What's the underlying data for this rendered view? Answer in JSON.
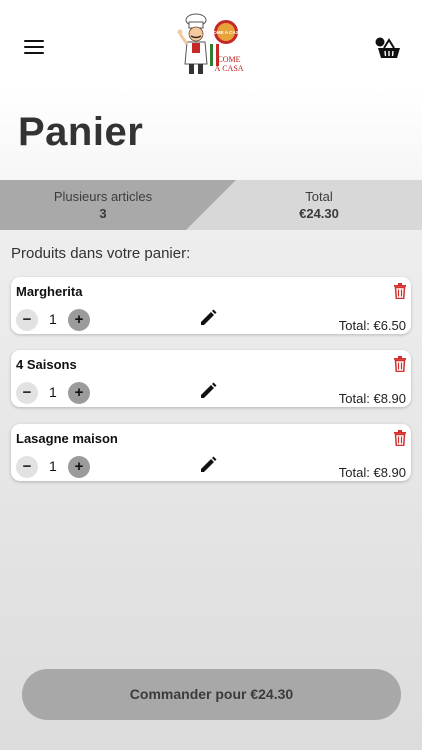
{
  "logo": {
    "brand_text_line1": "COME",
    "brand_text_line2": "À CASA",
    "badge_text": "COME A CASA"
  },
  "header": {
    "menu_icon": "hamburger-menu-icon",
    "cart_icon": "shopping-basket-icon"
  },
  "page": {
    "title": "Panier"
  },
  "summary": {
    "count_label": "Plusieurs articles",
    "count_value": "3",
    "total_label": "Total",
    "total_value": "€24.30"
  },
  "cart": {
    "section_label": "Produits dans votre panier:",
    "items": [
      {
        "name": "Margherita",
        "quantity": "1",
        "total": "Total: €6.50"
      },
      {
        "name": "4 Saisons",
        "quantity": "1",
        "total": "Total: €8.90"
      },
      {
        "name": "Lasagne maison",
        "quantity": "1",
        "total": "Total: €8.90"
      }
    ],
    "minus_glyph": "−",
    "plus_glyph": "+"
  },
  "order_button": {
    "label": "Commander pour €24.30"
  },
  "colors": {
    "delete_red": "#d32f2f",
    "button_gray": "#a8a8a8",
    "summary_dark": "#a9a9a9",
    "summary_light": "#d8d8d8"
  }
}
